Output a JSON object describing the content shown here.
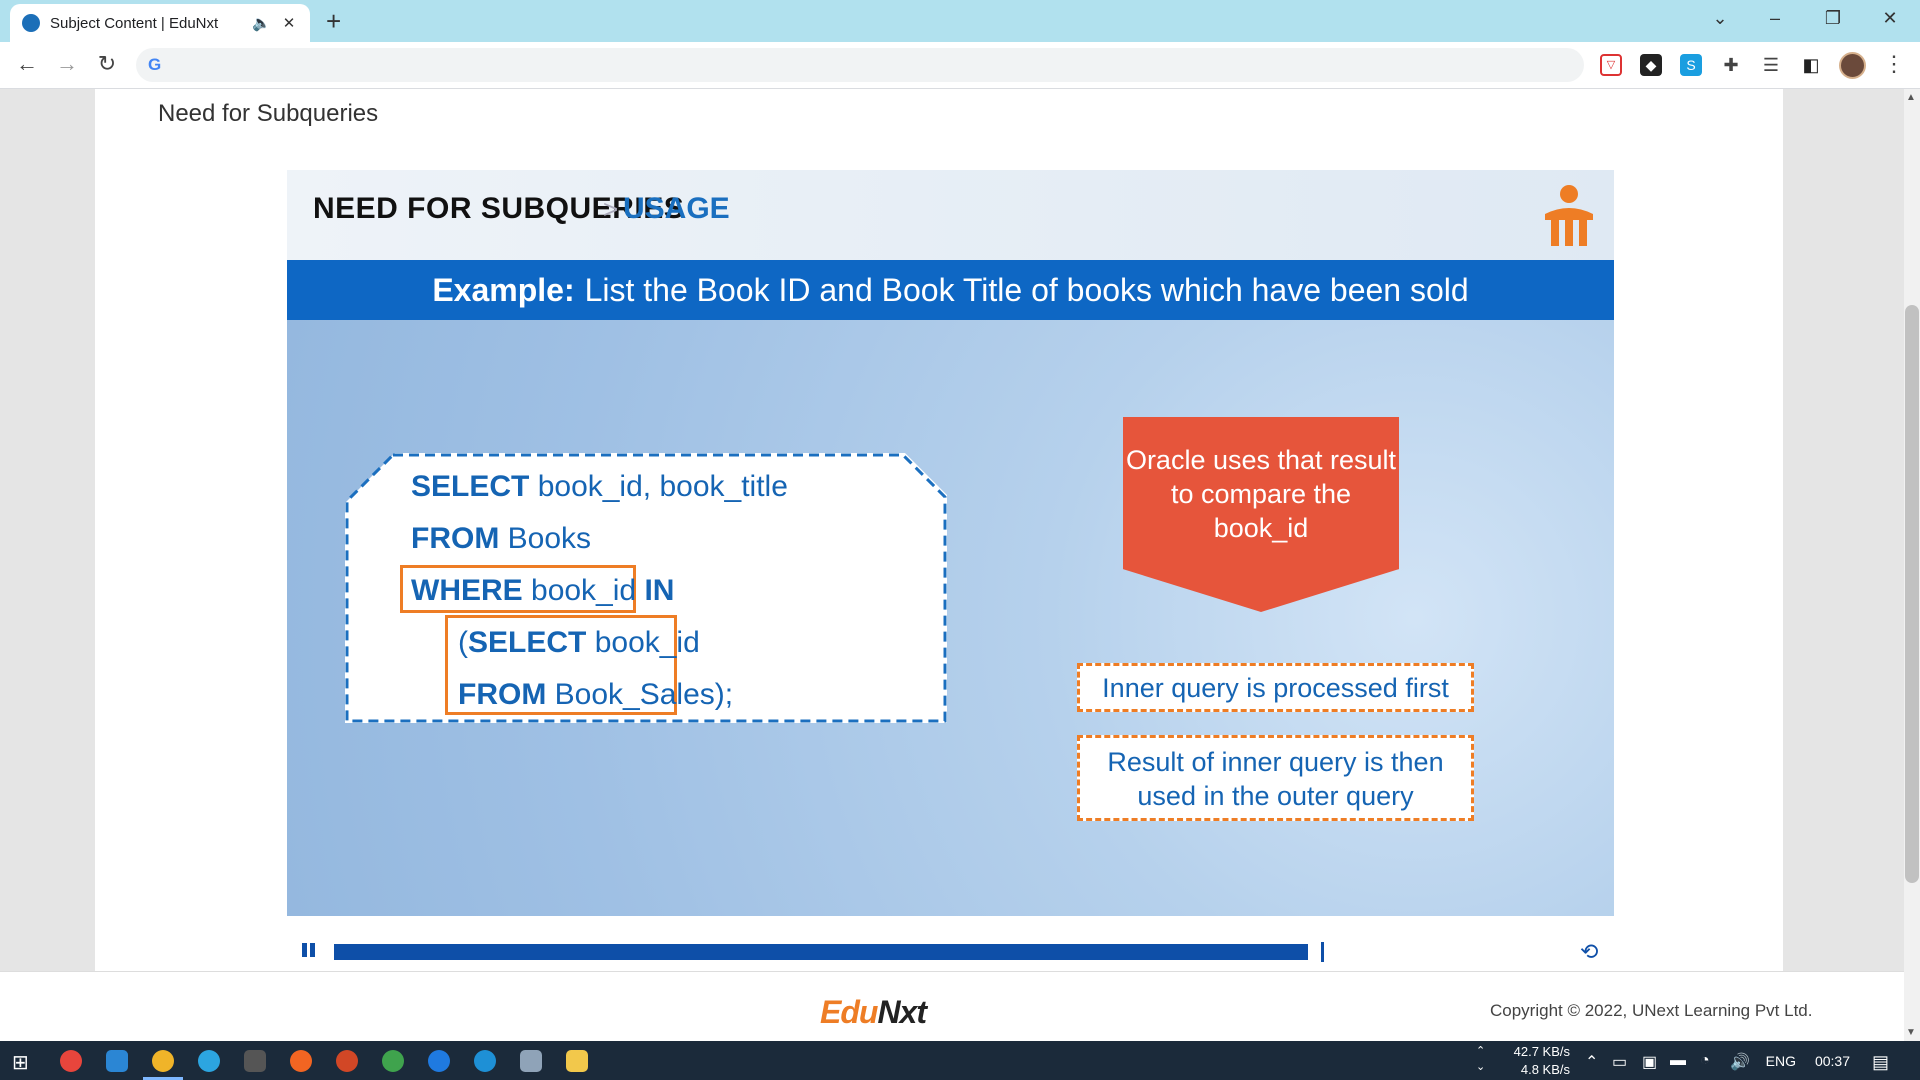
{
  "browser": {
    "tab_title": "Subject Content | EduNxt",
    "audio_icon": "speaker-icon",
    "close_icon": "close-icon",
    "new_tab": "+",
    "minimize": "–",
    "maximize": "❐",
    "close_window": "✕",
    "tab_search": "⌄"
  },
  "toolbar": {
    "back": "←",
    "forward": "→",
    "reload": "↻",
    "omnibox_value": "",
    "google_g": "G"
  },
  "page": {
    "title": "Need for Subqueries"
  },
  "slide": {
    "breadcrumb_main": "NEED FOR SUBQUERIES",
    "breadcrumb_sep": ">",
    "breadcrumb_sub": "USAGE",
    "banner_label": "Example:",
    "banner_text": "List the Book ID and Book Title of books which have been sold",
    "code": {
      "l1_kw": "SELECT",
      "l1_rest": " book_id, book_title",
      "l2_kw": "FROM",
      "l2_rest": " Books",
      "l3_kw": "WHERE",
      "l3_mid": " book_id ",
      "l3_kw2": "IN",
      "l4_open": "(",
      "l4_kw": "SELECT",
      "l4_rest": " book_id",
      "l5_kw": "FROM",
      "l5_rest": " Book_Sales);"
    },
    "callout_line1": "Oracle uses that result",
    "callout_line2": "to compare the",
    "callout_line3": "book_id",
    "note1": "Inner query is processed first",
    "note2_line1": "Result of inner query is then",
    "note2_line2": "used in the outer query",
    "progress_fraction": 0.915
  },
  "footer": {
    "logo_part1": "Edu",
    "logo_part2": "N",
    "logo_part3": "xt",
    "copyright": "Copyright © 2022, UNext Learning Pvt Ltd."
  },
  "taskbar": {
    "net_up": "42.7 KB/s",
    "net_down": "4.8 KB/s",
    "lang": "ENG",
    "time": "00:37"
  }
}
